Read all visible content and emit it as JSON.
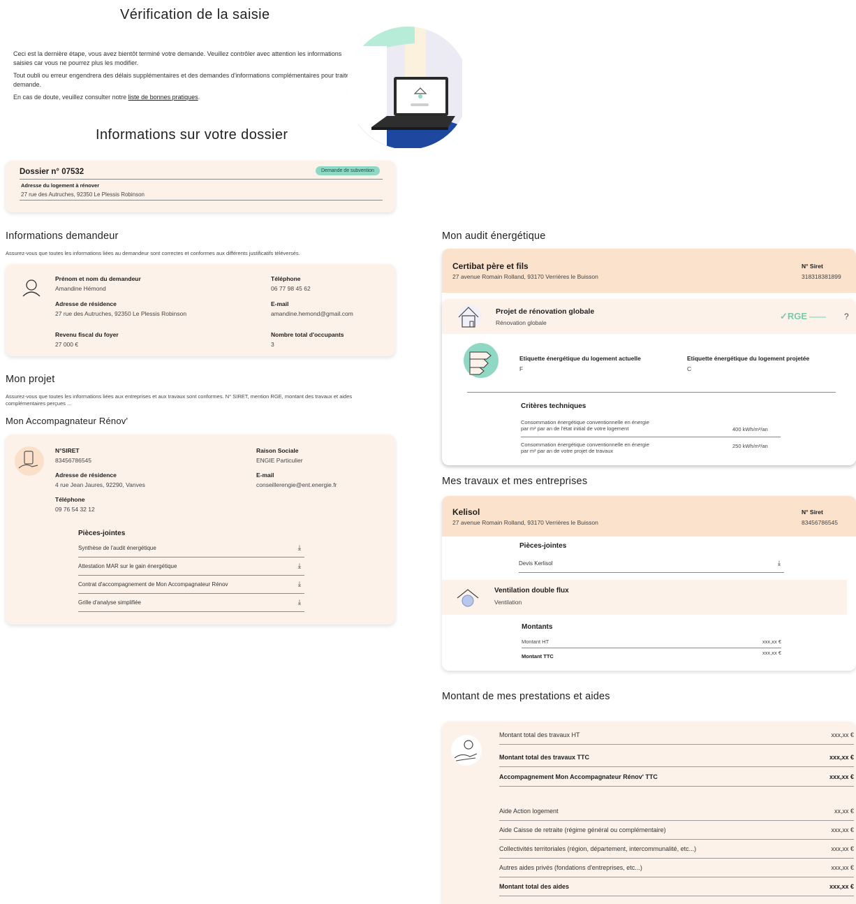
{
  "header": {
    "title": "Vérification de la saisie",
    "intro_1": "Ceci est la dernière étape, vous avez bientôt terminé votre demande. Veuillez contrôler avec attention les informations saisies car vous ne pourrez plus les modifier.",
    "intro_2": "Tout oubli ou erreur engendrera des délais supplémentaires et des demandes d'informations complémentaires pour traiter votre demande.",
    "intro_3_prefix": "En cas de doute, veuillez consulter notre ",
    "intro_3_link": "liste de bonnes pratiques",
    "intro_3_suffix": "."
  },
  "dossier": {
    "section_title": "Informations sur votre dossier",
    "number": "Dossier n° 07532",
    "badge": "Demande de subvention",
    "address_label": "Adresse du logement à rénover",
    "address_value": "27 rue des Autruches, 92350 Le Plessis Robinson"
  },
  "demandeur": {
    "title": "Informations demandeur",
    "subtitle": "Assurez-vous que toutes les informations liées au demandeur sont correctes et conformes aux différents justificatifs téléversés.",
    "name_label": "Prénom et nom du demandeur",
    "name_value": "Amandine Hémond",
    "phone_label": "Téléphone",
    "phone_value": "06 77 98 45 62",
    "address_label": "Adresse de résidence",
    "address_value": "27 rue des Autruches, 92350 Le Plessis Robinson",
    "email_label": "E-mail",
    "email_value": "amandine.hemond@gmail.com",
    "income_label": "Revenu fiscal du foyer",
    "income_value": "27 000 €",
    "occupants_label": "Nombre total d'occupants",
    "occupants_value": "3"
  },
  "projet": {
    "title": "Mon projet",
    "subtitle": "Assurez-vous que toutes les informations liées aux entreprises et aux travaux sont conformes. N° SIRET, mention RGE, montant des travaux et aides complémentaires perçues ..."
  },
  "accompagnateur": {
    "title": "Mon Accompagnateur Rénov'",
    "siret_label": "N°SIRET",
    "siret_value": "83456786545",
    "raison_label": "Raison Sociale",
    "raison_value": "ENGIE Particulier",
    "address_label": "Adresse de résidence",
    "address_value": "4 rue Jean Jaures, 92290, Vanves",
    "email_label": "E-mail",
    "email_value": "conseillerengie@ent.energie.fr",
    "phone_label": "Téléphone",
    "phone_value": "09 76 54 32 12",
    "attachments_title": "Pièces-jointes",
    "attachments": [
      {
        "label": "Synthèse de l'audit énergétique"
      },
      {
        "label": "Attestation MAR sur le gain énergétique"
      },
      {
        "label": "Contrat d'accompagnement de Mon Accompagnateur Rénov"
      },
      {
        "label": "Grille d'analyse simplifiée"
      }
    ]
  },
  "audit": {
    "title": "Mon audit énergétique",
    "company_name": "Certibat père et fils",
    "company_address": "27 avenue Romain Rolland, 93170 Verrières le Buisson",
    "siret_label": "N° Siret",
    "siret_value": "318318381899",
    "project_title": "Projet de rénovation globale",
    "project_subtitle": "Rénovation globale",
    "rge_label": "RGE",
    "help_label": "?",
    "label_current_title": "Etiquette énergétique du logement actuelle",
    "label_current_value": "F",
    "label_projected_title": "Etiquette énergétique du logement projetée",
    "label_projected_value": "C",
    "criteria_title": "Critères techniques",
    "criteria": [
      {
        "label_1": "Consommation énergétique conventionnelle en énergie",
        "label_2": "par m² par an de l'état initial de votre logement",
        "value": "400 kWh/m²/an"
      },
      {
        "label_1": "Consommation énergétique conventionnelle en énergie",
        "label_2": "par m² par an de votre projet de travaux",
        "value": "250 kWh/m²/an"
      }
    ]
  },
  "travaux": {
    "title": "Mes travaux et mes entreprises",
    "company_name": "Kelisol",
    "company_address": "27 avenue Romain Rolland, 93170 Verrières le Buisson",
    "siret_label": "N° Siret",
    "siret_value": "83456786545",
    "attachments_title": "Pièces-jointes",
    "attachment": "Devis Kerlisol",
    "work_title": "Ventilation double flux",
    "work_subtitle": "Ventilation",
    "amounts_title": "Montants",
    "ht_label": "Montant HT",
    "ht_value": "xxx,xx €",
    "ttc_label": "Montant TTC",
    "ttc_value": "xxx,xx €"
  },
  "prestations": {
    "title": "Montant de mes prestations et aides",
    "rows": [
      {
        "label": "Montant total des travaux HT",
        "value": "xxx,xx €"
      },
      {
        "label": "Montant total des travaux TTC",
        "value": "xxx,xx €"
      },
      {
        "label": "Accompagnement Mon Accompagnateur Rénov' TTC",
        "value": "xxx,xx €"
      },
      {
        "label": "Aide Action logement",
        "value": "xx,xx €"
      },
      {
        "label": "Aide Caisse de retraite (régime général ou complémentaire)",
        "value": "xxx,xx €"
      },
      {
        "label": "Collectivités territoriales (région, département, intercommunalité, etc...)",
        "value": "xxx,xx €"
      },
      {
        "label": "Autres aides privés (fondations d'entreprises, etc...)",
        "value": "xxx,xx €"
      },
      {
        "label": "Montant total des aides",
        "value": "xxx,xx €"
      }
    ]
  },
  "colors": {
    "card_bg": "#fdf2ea",
    "header_band": "#fbe2cc",
    "badge": "#8fd9c4",
    "rge_green": "#7cc9a6",
    "mint": "#b7ecd8",
    "navy": "#1e47a0"
  }
}
